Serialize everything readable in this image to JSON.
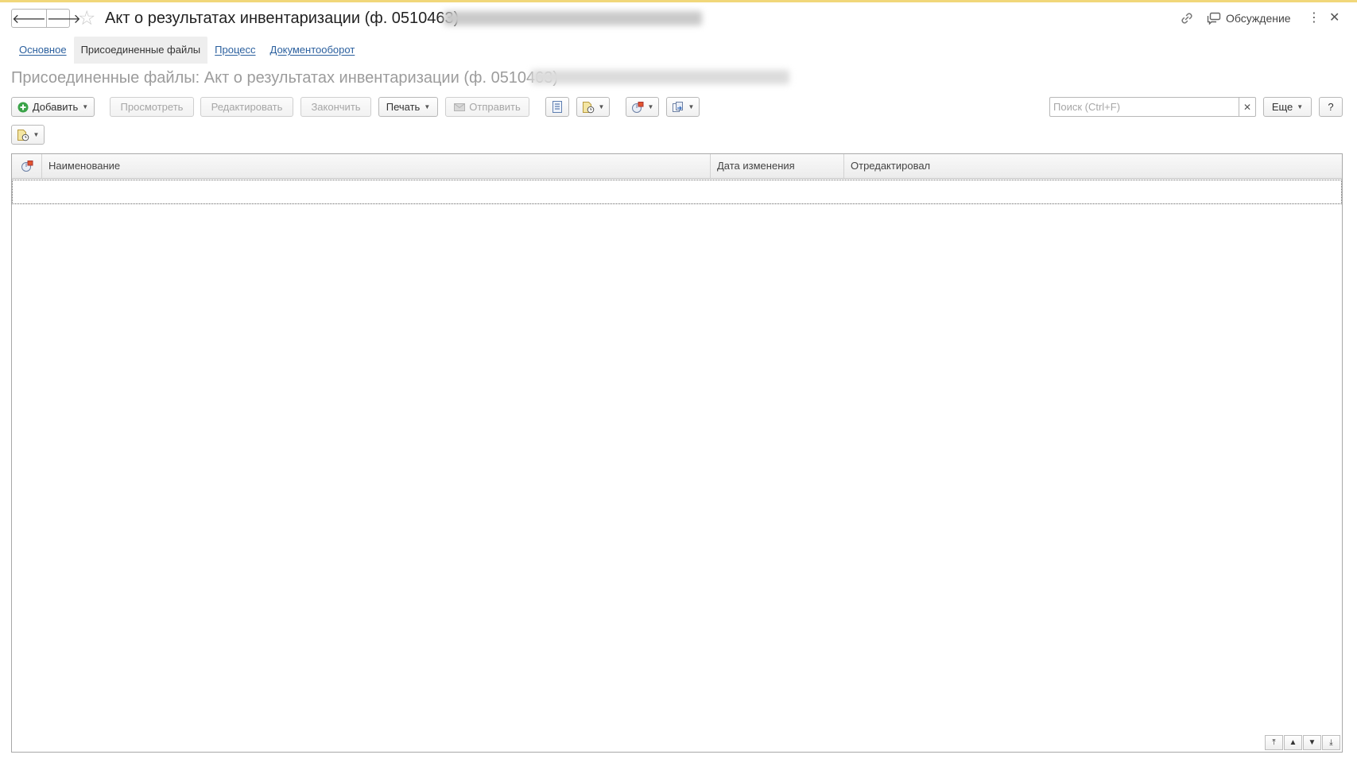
{
  "window": {
    "title": "Акт о результатах инвентаризации (ф. 0510463)",
    "discussion_label": "Обсуждение"
  },
  "tabs": [
    {
      "label": "Основное"
    },
    {
      "label": "Присоединенные файлы"
    },
    {
      "label": "Процесс"
    },
    {
      "label": "Документооборот"
    }
  ],
  "page": {
    "title": "Присоединенные файлы: Акт о результатах инвентаризации (ф. 0510463)"
  },
  "toolbar": {
    "add_label": "Добавить",
    "view_label": "Просмотреть",
    "edit_label": "Редактировать",
    "finish_label": "Закончить",
    "print_label": "Печать",
    "send_label": "Отправить",
    "more_label": "Еще",
    "help_label": "?"
  },
  "search": {
    "placeholder": "Поиск (Ctrl+F)",
    "value": ""
  },
  "table": {
    "columns": [
      "Наименование",
      "Дата изменения",
      "Отредактировал"
    ],
    "rows": []
  },
  "icons": {
    "back": "arrow-left-icon",
    "forward": "arrow-right-icon",
    "favorite": "star-icon",
    "link": "link-icon",
    "discussion": "discussion-icon",
    "add": "plus-circle-icon",
    "send": "envelope-icon"
  },
  "colors": {
    "link": "#2a5f9e",
    "accent_line": "#f1d77a",
    "add_icon": "#3aa348"
  }
}
